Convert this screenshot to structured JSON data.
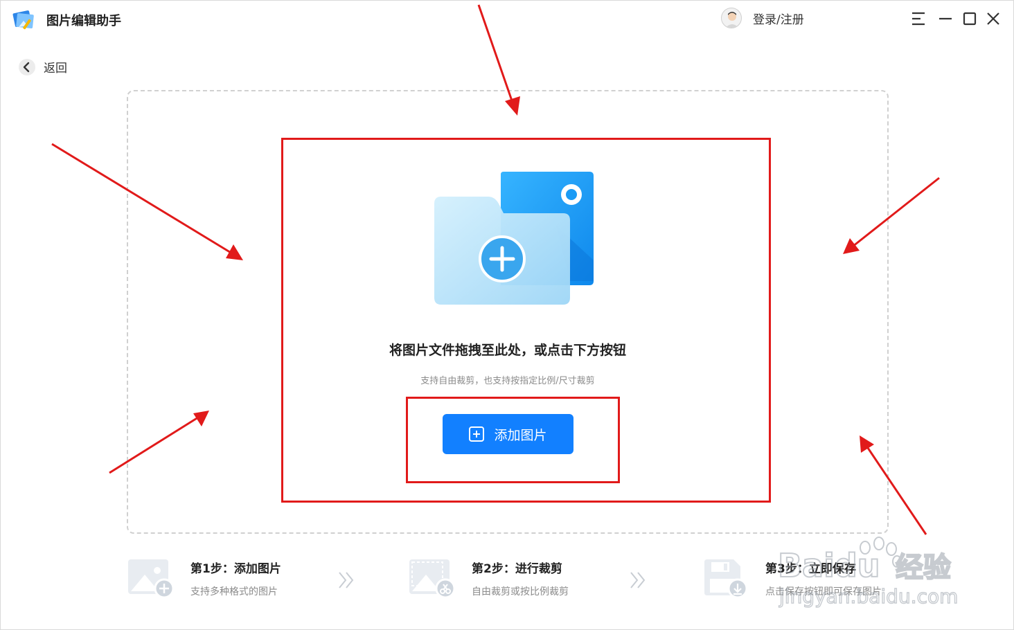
{
  "app": {
    "title": "图片编辑助手",
    "login_label": "登录/注册",
    "back_label": "返回"
  },
  "dropzone": {
    "title": "将图片文件拖拽至此处，或点击下方按钮",
    "subtitle": "支持自由裁剪，也支持按指定比例/尺寸裁剪",
    "add_button_label": "添加图片"
  },
  "steps": [
    {
      "title": "第1步：添加图片",
      "desc": "支持多种格式的图片",
      "icon": "image-add-icon"
    },
    {
      "title": "第2步：进行裁剪",
      "desc": "自由裁剪或按比例裁剪",
      "icon": "image-crop-icon"
    },
    {
      "title": "第3步：立即保存",
      "desc": "点击保存按钮即可保存图片",
      "icon": "save-icon"
    }
  ],
  "watermark": {
    "brand": "Baidu",
    "brand_cn": "经验",
    "url": "jingyan.baidu.com"
  },
  "colors": {
    "accent": "#1280ff",
    "annotation": "#e11a1a",
    "folder_back": "#1a9bf5",
    "folder_front": "#bfe6fb"
  }
}
